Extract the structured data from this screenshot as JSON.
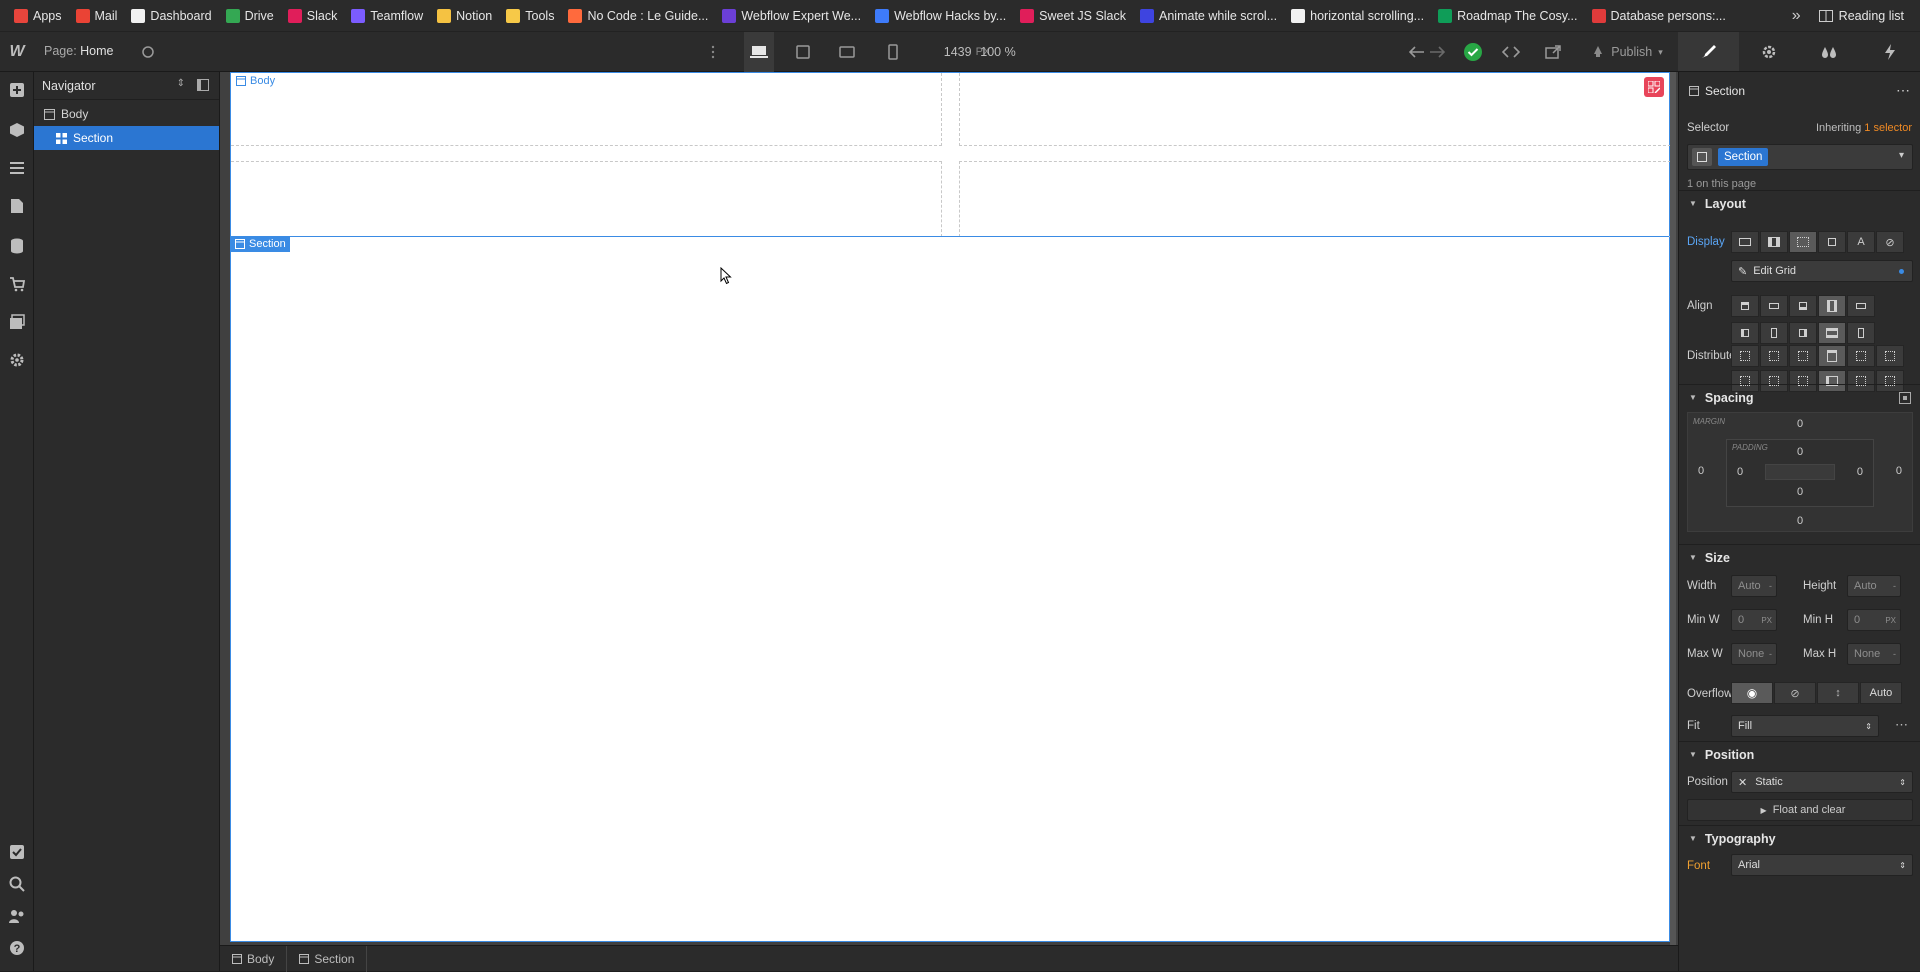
{
  "bookmarks": {
    "items": [
      {
        "label": "Apps",
        "color": "#e8453c"
      },
      {
        "label": "Mail",
        "color": "#ea4335"
      },
      {
        "label": "Dashboard",
        "color": "#f1f1f1"
      },
      {
        "label": "Drive",
        "color": "#34a853"
      },
      {
        "label": "Slack",
        "color": "#e01e5a"
      },
      {
        "label": "Teamflow",
        "color": "#7b5cff"
      },
      {
        "label": "Notion",
        "color": "#f5c242"
      },
      {
        "label": "Tools",
        "color": "#f7c948"
      },
      {
        "label": "No Code : Le Guide...",
        "color": "#ff6a3d"
      },
      {
        "label": "Webflow Expert We...",
        "color": "#6b3fd6"
      },
      {
        "label": "Webflow Hacks by...",
        "color": "#3e7bfa"
      },
      {
        "label": "Sweet JS Slack",
        "color": "#e01e5a"
      },
      {
        "label": "Animate while scrol...",
        "color": "#3e44e0"
      },
      {
        "label": "horizontal scrolling...",
        "color": "#f1f1f1"
      },
      {
        "label": "Roadmap The Cosy...",
        "color": "#0f9d58"
      },
      {
        "label": "Database persons:...",
        "color": "#e03b3b"
      }
    ],
    "more": "»",
    "reading_list": "Reading list"
  },
  "topbar": {
    "page_prefix": "Page:",
    "page_name": "Home",
    "width_value": "1439",
    "width_unit": "PX",
    "zoom": "100 %",
    "publish": "Publish"
  },
  "navigator": {
    "title": "Navigator",
    "items": [
      {
        "label": "Body"
      },
      {
        "label": "Section"
      }
    ]
  },
  "canvas": {
    "body_tag": "Body",
    "section_tag": "Section"
  },
  "breadcrumbs": [
    "Body",
    "Section"
  ],
  "panel": {
    "element_name": "Section",
    "selector_label": "Selector",
    "inheriting_prefix": "Inheriting",
    "inheriting_link": "1 selector",
    "selector_chip": "Section",
    "on_page": "1 on this page",
    "layout": {
      "title": "Layout",
      "display_label": "Display",
      "edit_grid": "Edit Grid",
      "align_label": "Align",
      "distribute_label": "Distribute"
    },
    "spacing": {
      "title": "Spacing",
      "margin_label": "MARGIN",
      "padding_label": "PADDING",
      "margin_top": "0",
      "margin_right": "0",
      "margin_bottom": "0",
      "margin_left": "0",
      "padding_top": "0",
      "padding_right": "0",
      "padding_bottom": "0",
      "padding_left": "0"
    },
    "size": {
      "title": "Size",
      "width_label": "Width",
      "width_value": "Auto",
      "height_label": "Height",
      "height_value": "Auto",
      "minw_label": "Min W",
      "minw_value": "0",
      "minw_unit": "PX",
      "minh_label": "Min H",
      "minh_value": "0",
      "minh_unit": "PX",
      "maxw_label": "Max W",
      "maxw_value": "None",
      "maxh_label": "Max H",
      "maxh_value": "None",
      "overflow_label": "Overflow",
      "overflow_auto": "Auto",
      "fit_label": "Fit",
      "fit_value": "Fill"
    },
    "position": {
      "title": "Position",
      "label": "Position",
      "value": "Static",
      "float": "Float and clear"
    },
    "typography": {
      "title": "Typography",
      "font_label": "Font",
      "font_value": "Arial"
    }
  },
  "colors": {
    "accent": "#2b76d2",
    "link_orange": "#f08a24",
    "font_label_orange": "#f0a030",
    "publish_ok": "#28a745"
  }
}
